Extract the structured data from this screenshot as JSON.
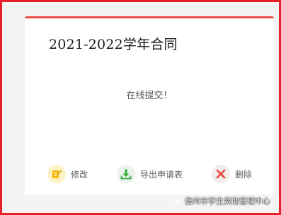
{
  "card": {
    "title": "2021-2022学年合同",
    "status": "在线提交！"
  },
  "actions": [
    {
      "label": "修改",
      "icon": "edit-icon",
      "color": "#f5b800"
    },
    {
      "label": "导出申请表",
      "icon": "download-icon",
      "color": "#2fae3a"
    },
    {
      "label": "删除",
      "icon": "delete-icon",
      "color": "#e8453c"
    }
  ],
  "watermark": {
    "text": "儋州市学生资助管理中心",
    "icon": "wechat-icon"
  },
  "colors": {
    "border": "#e8202a",
    "card_accent": "#ec4f47"
  }
}
